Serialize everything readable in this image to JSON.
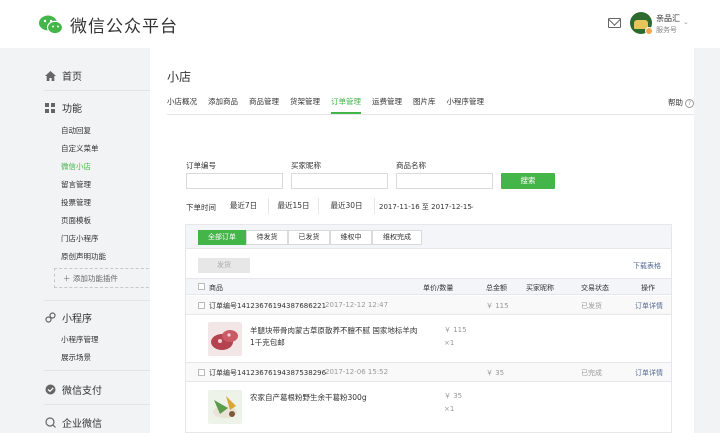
{
  "header": {
    "app_title": "微信公众平台",
    "account_name": "亲品汇",
    "account_type": "服务号"
  },
  "sidebar": {
    "home": "首页",
    "features": "功能",
    "feature_items": [
      "自动回复",
      "自定义菜单",
      "微信小店",
      "留言管理",
      "投票管理",
      "页面模板",
      "门店小程序",
      "原创声明功能"
    ],
    "active_item": "微信小店",
    "add_plugin": "＋ 添加功能插件",
    "miniprogram": "小程序",
    "miniprogram_items": [
      "小程序管理",
      "展示场景"
    ],
    "pay": "微信支付",
    "work": "企业微信"
  },
  "main": {
    "title": "小店",
    "tabs": [
      "小店概况",
      "添加商品",
      "商品管理",
      "货架管理",
      "订单管理",
      "运费管理",
      "图片库",
      "小程序管理"
    ],
    "active_tab": "订单管理",
    "help": "帮助",
    "filters": {
      "order_no_label": "订单编号",
      "buyer_label": "买家昵称",
      "product_label": "商品名称",
      "search_button": "搜索"
    },
    "date": {
      "label": "下单时间",
      "options": [
        "最近7日",
        "最近15日",
        "最近30日"
      ],
      "start": "2017-11-16",
      "to": "至",
      "end": "2017-12-15"
    },
    "status_tabs": [
      "全部订单",
      "待发货",
      "已发货",
      "维权中",
      "维权完成"
    ],
    "ship_button": "发货",
    "download": "下载表格",
    "columns": {
      "product": "商品",
      "price_qty": "单价/数量",
      "total": "总金额",
      "buyer": "买家昵称",
      "status": "交易状态",
      "op": "操作"
    },
    "orders": [
      {
        "id": "订单编号14123676194387686221",
        "time": "2017-12-12 12:47",
        "total": "￥ 115",
        "status": "已发货",
        "op": "订单详情",
        "product": "羊腿块带骨肉蒙古草原散养不膻不腻 国家地标羊肉1千克包邮",
        "price": "￥ 115",
        "qty": "×1"
      },
      {
        "id": "订单编号14123676194387538296",
        "time": "2017-12-06 15:52",
        "total": "￥ 35",
        "status": "已完成",
        "op": "订单详情",
        "product": "农家自产葛根粉野生余干葛粉300g",
        "price": "￥ 35",
        "qty": "×1"
      }
    ]
  }
}
